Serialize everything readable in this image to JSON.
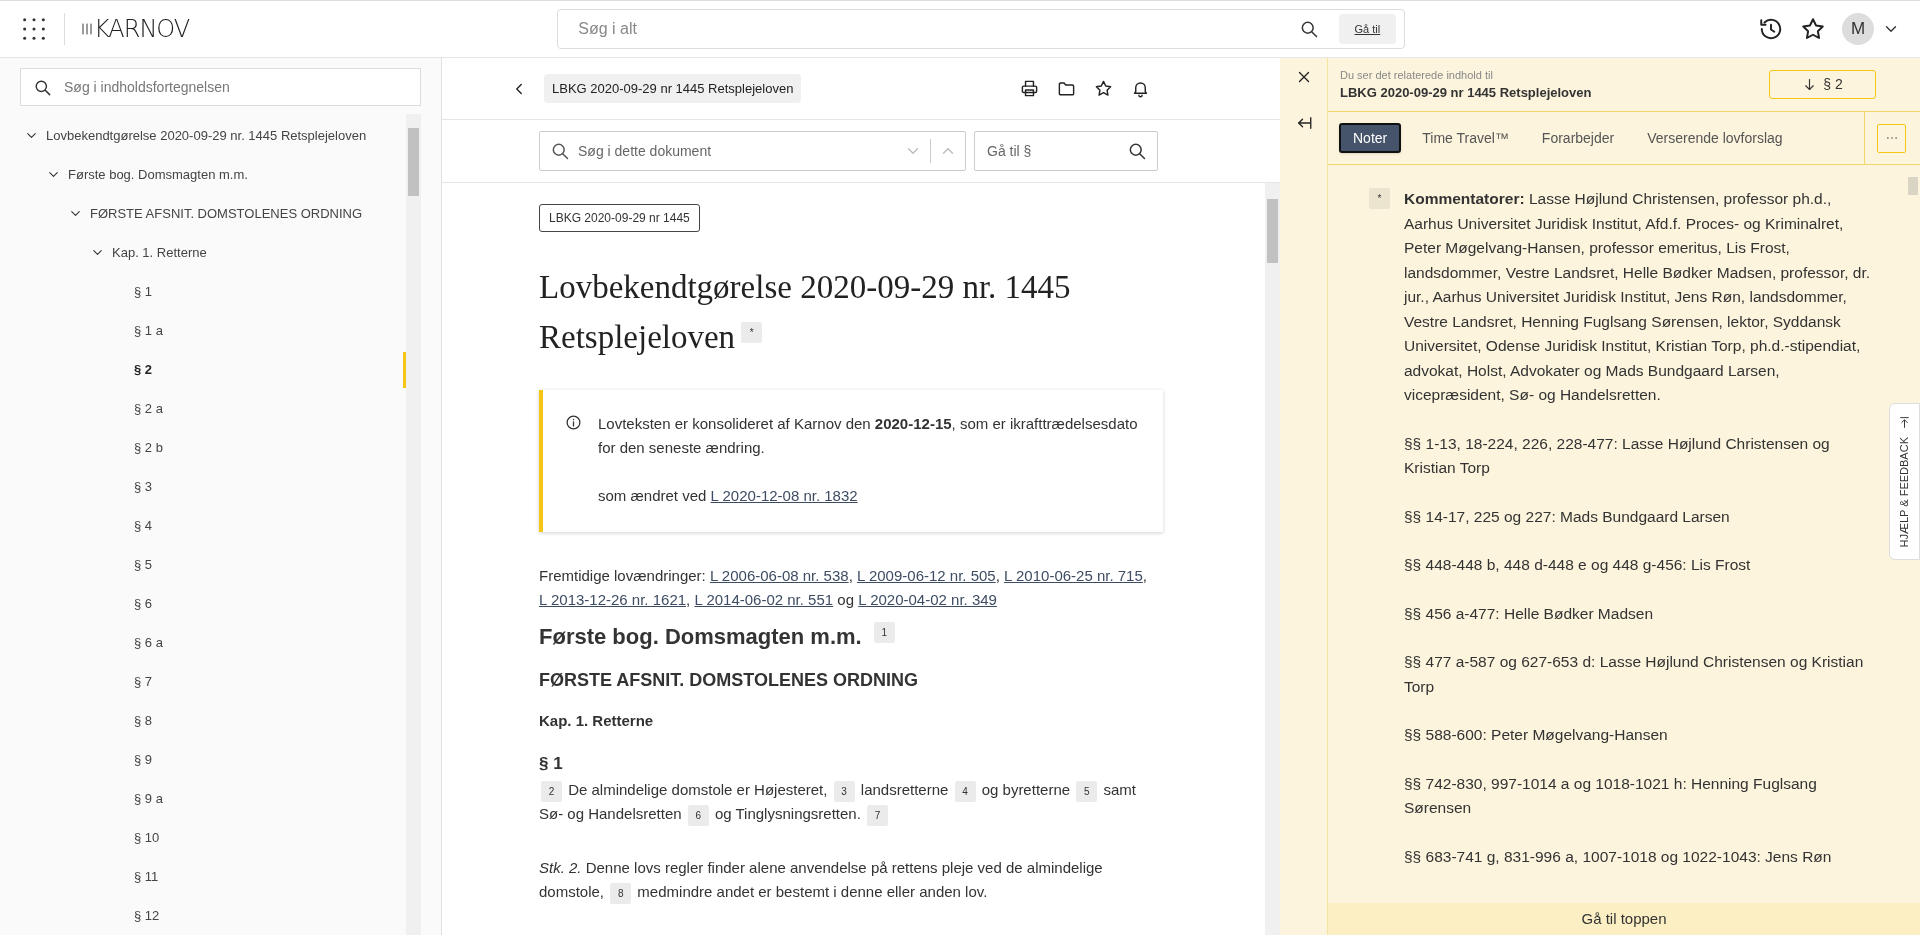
{
  "header": {
    "logo": "KARNOV",
    "search": {
      "placeholder": "Søg i alt",
      "button": "Gå til"
    },
    "avatar": "M"
  },
  "toc": {
    "search_placeholder": "Søg i indholdsfortegnelsen",
    "items": [
      {
        "label": "Lovbekendtgørelse 2020-09-29 nr. 1445 Retsplejeloven",
        "selected": false,
        "expanded": true,
        "children": [
          {
            "label": "Første bog. Domsmagten m.m.",
            "selected": false,
            "expanded": true,
            "children": [
              {
                "label": "FØRSTE AFSNIT. DOMSTOLENES ORDNING",
                "selected": false,
                "expanded": true,
                "children": [
                  {
                    "label": "Kap. 1. Retterne",
                    "selected": false,
                    "expanded": true,
                    "children": [
                      {
                        "label": "§ 1",
                        "selected": false
                      },
                      {
                        "label": "§ 1 a",
                        "selected": false
                      },
                      {
                        "label": "§ 2",
                        "selected": true
                      },
                      {
                        "label": "§ 2 a",
                        "selected": false
                      },
                      {
                        "label": "§ 2 b",
                        "selected": false
                      },
                      {
                        "label": "§ 3",
                        "selected": false
                      },
                      {
                        "label": "§ 4",
                        "selected": false
                      },
                      {
                        "label": "§ 5",
                        "selected": false
                      },
                      {
                        "label": "§ 6",
                        "selected": false
                      },
                      {
                        "label": "§ 6 a",
                        "selected": false
                      },
                      {
                        "label": "§ 7",
                        "selected": false
                      },
                      {
                        "label": "§ 8",
                        "selected": false
                      },
                      {
                        "label": "§ 9",
                        "selected": false
                      },
                      {
                        "label": "§ 9 a",
                        "selected": false
                      },
                      {
                        "label": "§ 10",
                        "selected": false
                      },
                      {
                        "label": "§ 11",
                        "selected": false
                      },
                      {
                        "label": "§ 12",
                        "selected": false
                      }
                    ]
                  }
                ]
              }
            ]
          }
        ]
      }
    ]
  },
  "document": {
    "breadcrumb": "LBKG 2020-09-29 nr 1445 Retsplejeloven",
    "search_placeholder": "Søg i dette dokument",
    "goto_placeholder": "Gå til §",
    "blocks": [
      {
        "kind": "badge",
        "text": "LBKG 2020-09-29 nr 1445"
      },
      {
        "kind": "title",
        "text": "Lovbekendtgørelse 2020-09-29 nr. 1445 Retsplejeloven",
        "note": "*"
      },
      {
        "kind": "info",
        "paragraphs": [
          [
            {
              "text": "Lovteksten er konsolideret af Karnov den **2020-12-15**, som er ikrafttrædelsesdato for den seneste ændring."
            }
          ],
          [
            {
              "text": "som ændret ved "
            },
            {
              "link": "L 2020-12-08 nr. 1832"
            }
          ]
        ]
      },
      {
        "kind": "para",
        "parts": [
          {
            "text": "Fremtidige lovændringer: "
          },
          {
            "link": "L 2006-06-08 nr. 538"
          },
          {
            "text": ", "
          },
          {
            "link": "L 2009-06-12 nr. 505"
          },
          {
            "text": ", "
          },
          {
            "link": "L 2010-06-25 nr. 715"
          },
          {
            "text": ", "
          },
          {
            "link": "L 2013-12-26 nr. 1621"
          },
          {
            "text": ", "
          },
          {
            "link": "L 2014-06-02 nr. 551"
          },
          {
            "text": " og "
          },
          {
            "link": "L 2020-04-02 nr. 349"
          }
        ]
      },
      {
        "kind": "section",
        "text": "Første bog. Domsmagten m.m.",
        "note": "1"
      },
      {
        "kind": "part",
        "text": "FØRSTE AFSNIT. DOMSTOLENES ORDNING"
      },
      {
        "kind": "chapter",
        "text": "Kap. 1. Retterne"
      },
      {
        "kind": "paragraph_heading",
        "text": "§ 1"
      },
      {
        "kind": "para",
        "parts": [
          {
            "note": "2"
          },
          {
            "text": " De almindelige domstole er Højesteret, "
          },
          {
            "note": "3"
          },
          {
            "text": " landsretterne "
          },
          {
            "note": "4"
          },
          {
            "text": " og byretterne "
          },
          {
            "note": "5"
          },
          {
            "text": " samt Sø- og Handelsretten "
          },
          {
            "note": "6"
          },
          {
            "text": " og Tinglysningsretten. "
          },
          {
            "note": "7"
          }
        ]
      },
      {
        "kind": "para",
        "parts": [
          {
            "text": "*Stk. 2.* Denne lovs regler finder alene anvendelse på rettens pleje ved de almindelige domstole, "
          },
          {
            "note": "8"
          },
          {
            "text": " medmindre andet er bestemt i denne eller anden lov."
          }
        ]
      }
    ]
  },
  "related": {
    "caption": "Du ser det relaterede indhold til",
    "title": "LBKG 2020-09-29 nr 1445 Retsplejeloven",
    "jump_button": "§ 2",
    "tabs": [
      {
        "label": "Noter",
        "selected": true
      },
      {
        "label": "Time Travel™",
        "selected": false
      },
      {
        "label": "Forarbejder",
        "selected": false
      },
      {
        "label": "Verserende lovforslag",
        "selected": false
      }
    ],
    "notes": [
      {
        "marker": "*",
        "text": "**Kommentatorer:** Lasse Højlund Christensen, professor ph.d., Aarhus Universitet Juridisk Institut, Afd.f. Proces- og Kriminalret, Peter Møgelvang-Hansen, professor emeritus, Lis Frost, landsdommer, Vestre Landsret, Helle Bødker Madsen, professor, dr. jur., Aarhus Universitet Juridisk Institut, Jens Røn, landsdommer, Vestre Landsret, Henning Fuglsang Sørensen, lektor, Syddansk Universitet, Odense Juridisk Institut, Kristian Torp, ph.d.-stipendiat, advokat, Holst, Advokater og Mads Bundgaard Larsen, vicepræsident, Sø- og Handelsretten."
      },
      {
        "text": "§§ 1-13, 18-224, 226, 228-477: Lasse Højlund Christensen og Kristian Torp"
      },
      {
        "text": "§§ 14-17, 225 og 227: Mads Bundgaard Larsen"
      },
      {
        "text": "§§ 448-448 b, 448 d-448 e og 448 g-456: Lis Frost"
      },
      {
        "text": "§§ 456 a-477: Helle Bødker Madsen"
      },
      {
        "text": "§§ 477 a-587 og 627-653 d: Lasse Højlund Christensen og Kristian Torp"
      },
      {
        "text": "§§ 588-600: Peter Møgelvang-Hansen"
      },
      {
        "text": "§§ 742-830, 997-1014 a og 1018-1021 h: Henning Fuglsang Sørensen"
      },
      {
        "text": "§§ 683-741 g, 831-996 a, 1007-1018 og 1022-1043: Jens Røn"
      }
    ],
    "footer_button": "Gå til toppen"
  },
  "feedback_tab": "HJÆLP & FEEDBACK"
}
